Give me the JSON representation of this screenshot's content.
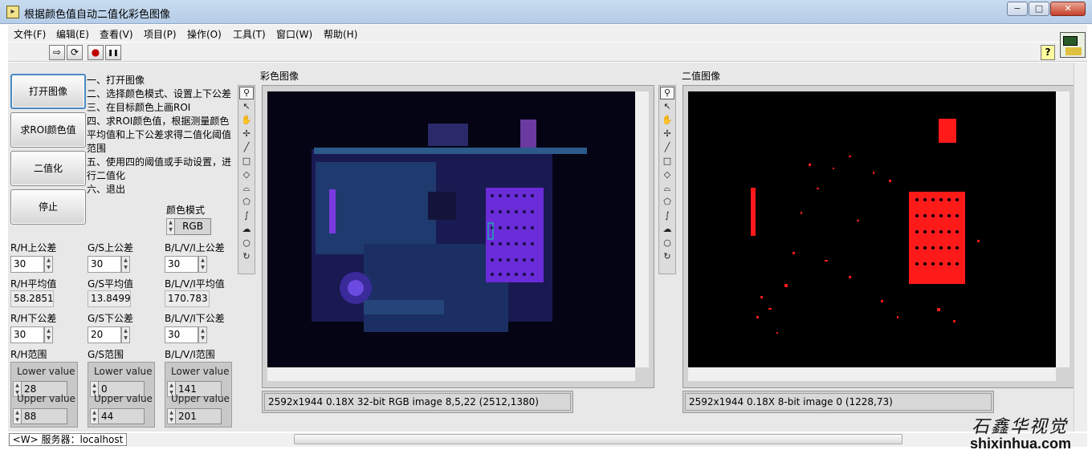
{
  "window": {
    "title": "根据颜色值自动二值化彩色图像",
    "icon": "labview-vi-icon",
    "min": "−",
    "max": "□",
    "close": "✕"
  },
  "menu": [
    "文件(F)",
    "编辑(E)",
    "查看(V)",
    "项目(P)",
    "操作(O)",
    "工具(T)",
    "窗口(W)",
    "帮助(H)"
  ],
  "toolbar": {
    "run": "⇨",
    "run_continuous": "⟳",
    "abort": "●",
    "pause": "❚❚",
    "help": "?"
  },
  "buttons": {
    "open": "打开图像",
    "roi": "求ROI颜色值",
    "binarize": "二值化",
    "stop": "停止"
  },
  "instructions": [
    "一、打开图像",
    "二、选择颜色模式、设置上下公差",
    "三、在目标颜色上画ROI",
    "四、求ROI颜色值，根据测量颜色平均值和上下公差求得二值化阈值范围",
    "五、使用四的阈值或手动设置，进行二值化",
    "六、退出"
  ],
  "color_mode": {
    "label": "颜色模式",
    "value": "RGB"
  },
  "upper_tol": {
    "rh": {
      "label": "R/H上公差",
      "value": "30"
    },
    "gs": {
      "label": "G/S上公差",
      "value": "30"
    },
    "bl": {
      "label": "B/L/V/I上公差",
      "value": "30"
    }
  },
  "mean": {
    "rh": {
      "label": "R/H平均值",
      "value": "58.2851"
    },
    "gs": {
      "label": "G/S平均值",
      "value": "13.8499"
    },
    "bl": {
      "label": "B/L/V/I平均值",
      "value": "170.783"
    }
  },
  "lower_tol": {
    "rh": {
      "label": "R/H下公差",
      "value": "30"
    },
    "gs": {
      "label": "G/S下公差",
      "value": "20"
    },
    "bl": {
      "label": "B/L/V/I下公差",
      "value": "30"
    }
  },
  "range": {
    "rh": {
      "label": "R/H范围",
      "lower_label": "Lower value",
      "lower": "28",
      "upper_label": "Upper value",
      "upper": "88"
    },
    "gs": {
      "label": "G/S范围",
      "lower_label": "Lower value",
      "lower": "0",
      "upper_label": "Upper value",
      "upper": "44"
    },
    "bl": {
      "label": "B/L/V/I范围",
      "lower_label": "Lower value",
      "lower": "141",
      "upper_label": "Upper value",
      "upper": "201"
    }
  },
  "color_image": {
    "label": "彩色图像",
    "status": "2592x1944 0.18X 32-bit RGB image 8,5,22     (2512,1380)"
  },
  "binary_image": {
    "label": "二值图像",
    "status": "2592x1944 0.18X 8-bit image 0     (1228,73)"
  },
  "server": "<W> 服务器：localhost",
  "watermark": {
    "cn": "石鑫华视觉",
    "url": "shixinhua.com"
  },
  "colors": {
    "pcb": "#2a2a7a",
    "binary_red": "#ff1a1a"
  }
}
